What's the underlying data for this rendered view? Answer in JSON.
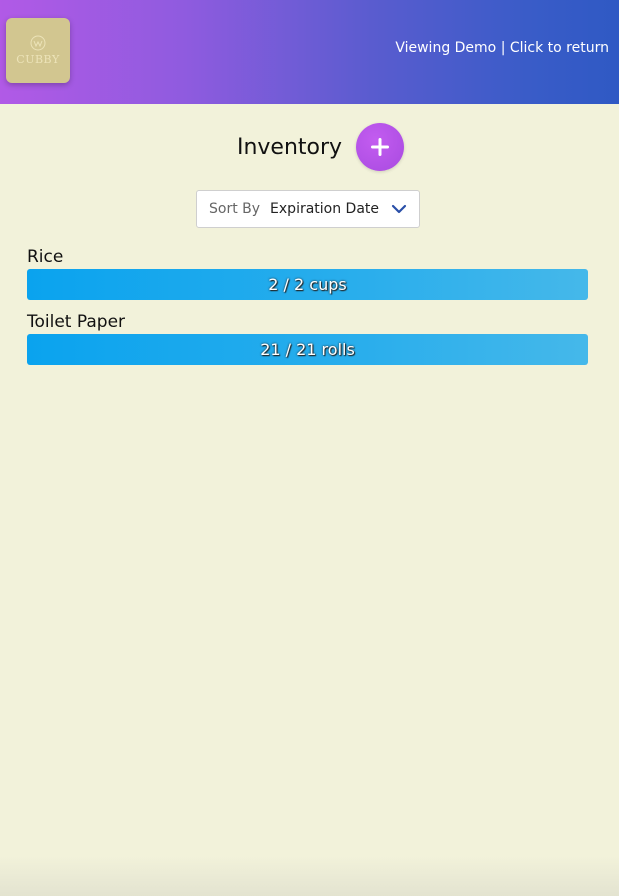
{
  "header": {
    "logo_text": "CUBBY",
    "demo_link": "Viewing Demo | Click to return",
    "gradient_start": "#b15ae6",
    "gradient_end": "#2f59c4"
  },
  "page": {
    "title": "Inventory",
    "add_icon": "plus-icon"
  },
  "sort": {
    "label": "Sort By",
    "value": "Expiration Date",
    "icon": "chevron-down-icon"
  },
  "items": [
    {
      "name": "Rice",
      "quantity_text": "2 / 2 cups",
      "fill_percent": 100
    },
    {
      "name": "Toilet Paper",
      "quantity_text": "21 / 21 rolls",
      "fill_percent": 100
    }
  ],
  "colors": {
    "background": "#f2f2da",
    "accent": "#b05ae8",
    "bar": "#0aa3ee"
  }
}
